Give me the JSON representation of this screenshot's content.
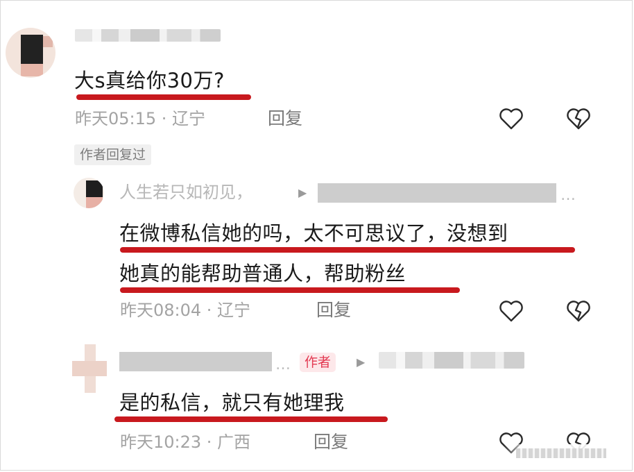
{
  "comments": [
    {
      "text": "大s真给你30万?",
      "meta": "昨天05:15 · 辽宁",
      "reply_label": "回复",
      "author_replied_tag": "作者回复过"
    }
  ],
  "replies": [
    {
      "nickname": "人生若只如初见，",
      "line1": "在微博私信她的吗，太不可思议了，没想到",
      "line2": "她真的能帮助普通人，帮助粉丝",
      "meta": "昨天08:04 · 辽宁",
      "reply_label": "回复"
    },
    {
      "author_badge": "作者",
      "text": "是的私信，就只有她理我",
      "meta": "昨天10:23 · 广西",
      "reply_label": "回复"
    }
  ],
  "ellipsis": "…",
  "arrow": "▶",
  "icons": {
    "like": "heart-outline",
    "dislike": "broken-heart-outline"
  },
  "colors": {
    "underline": "#c8191e",
    "author_badge_bg": "#fde8ea",
    "author_badge_text": "#e33a52"
  }
}
